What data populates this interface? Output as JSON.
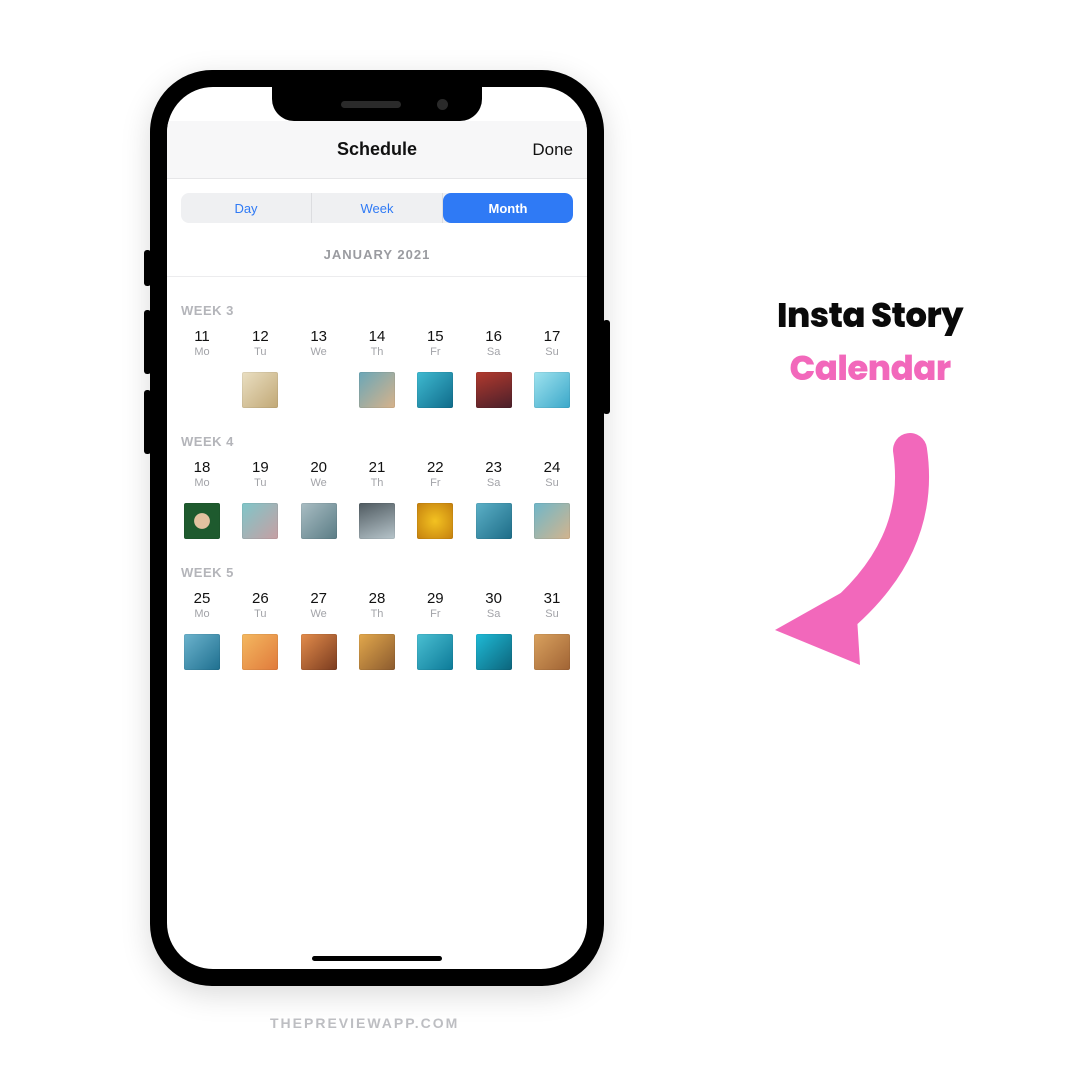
{
  "header": {
    "title": "Schedule",
    "done": "Done"
  },
  "segments": {
    "day": "Day",
    "week": "Week",
    "month": "Month",
    "active": "Month"
  },
  "monthLabel": "JANUARY 2021",
  "dayAbbr": [
    "Mo",
    "Tu",
    "We",
    "Th",
    "Fr",
    "Sa",
    "Su"
  ],
  "weeks": [
    {
      "label": "WEEK 3",
      "days": [
        11,
        12,
        13,
        14,
        15,
        16,
        17
      ],
      "thumbs": [
        "",
        "t-a",
        "",
        "t-b",
        "t-c",
        "t-d",
        "t-e"
      ]
    },
    {
      "label": "WEEK 4",
      "days": [
        18,
        19,
        20,
        21,
        22,
        23,
        24
      ],
      "thumbs": [
        "t-f",
        "t-g",
        "t-h",
        "t-i",
        "t-j",
        "t-k",
        "t-l"
      ]
    },
    {
      "label": "WEEK 5",
      "days": [
        25,
        26,
        27,
        28,
        29,
        30,
        31
      ],
      "thumbs": [
        "t-m",
        "t-n",
        "t-o",
        "t-p",
        "t-q",
        "t-r",
        "t-s"
      ]
    }
  ],
  "side": {
    "line1": "Insta Story",
    "line2": "Calendar"
  },
  "footer": "THEPREVIEWAPP.COM",
  "colors": {
    "accent": "#2f7af5",
    "pink": "#f268bb"
  }
}
